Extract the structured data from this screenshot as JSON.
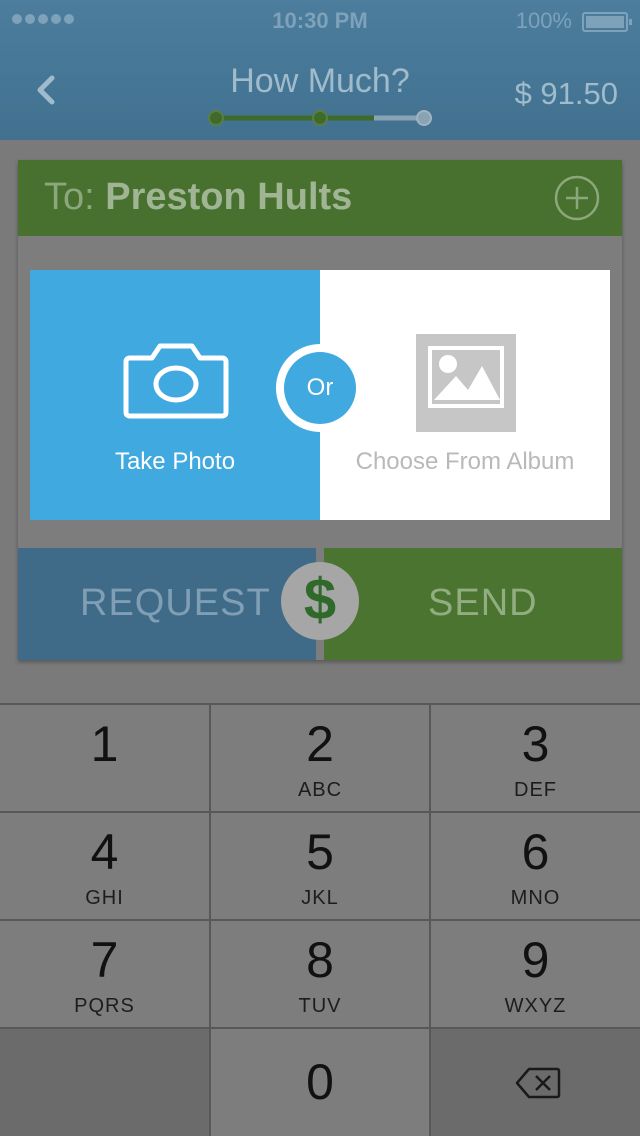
{
  "status_bar": {
    "time": "10:30 PM",
    "battery": "100%",
    "signal_dots": 5
  },
  "nav": {
    "title": "How Much?",
    "amount": "$ 91.50",
    "progress_step": 2,
    "progress_total": 3
  },
  "recipient": {
    "prefix": "To: ",
    "name": "Preston Hults"
  },
  "picker": {
    "take_photo": "Take Photo",
    "or": "Or",
    "choose_album": "Choose From Album"
  },
  "actions": {
    "request": "REQUEST",
    "send": "SEND",
    "dollar": "$"
  },
  "keypad": {
    "keys": [
      {
        "num": "1",
        "letters": ""
      },
      {
        "num": "2",
        "letters": "ABC"
      },
      {
        "num": "3",
        "letters": "DEF"
      },
      {
        "num": "4",
        "letters": "GHI"
      },
      {
        "num": "5",
        "letters": "JKL"
      },
      {
        "num": "6",
        "letters": "MNO"
      },
      {
        "num": "7",
        "letters": "PQRS"
      },
      {
        "num": "8",
        "letters": "TUV"
      },
      {
        "num": "9",
        "letters": "WXYZ"
      },
      {
        "num": "0",
        "letters": ""
      }
    ]
  },
  "colors": {
    "take_photo_bg": "#3fa9e0",
    "send_green": "#4a7430",
    "request_blue": "#3f6b88"
  }
}
